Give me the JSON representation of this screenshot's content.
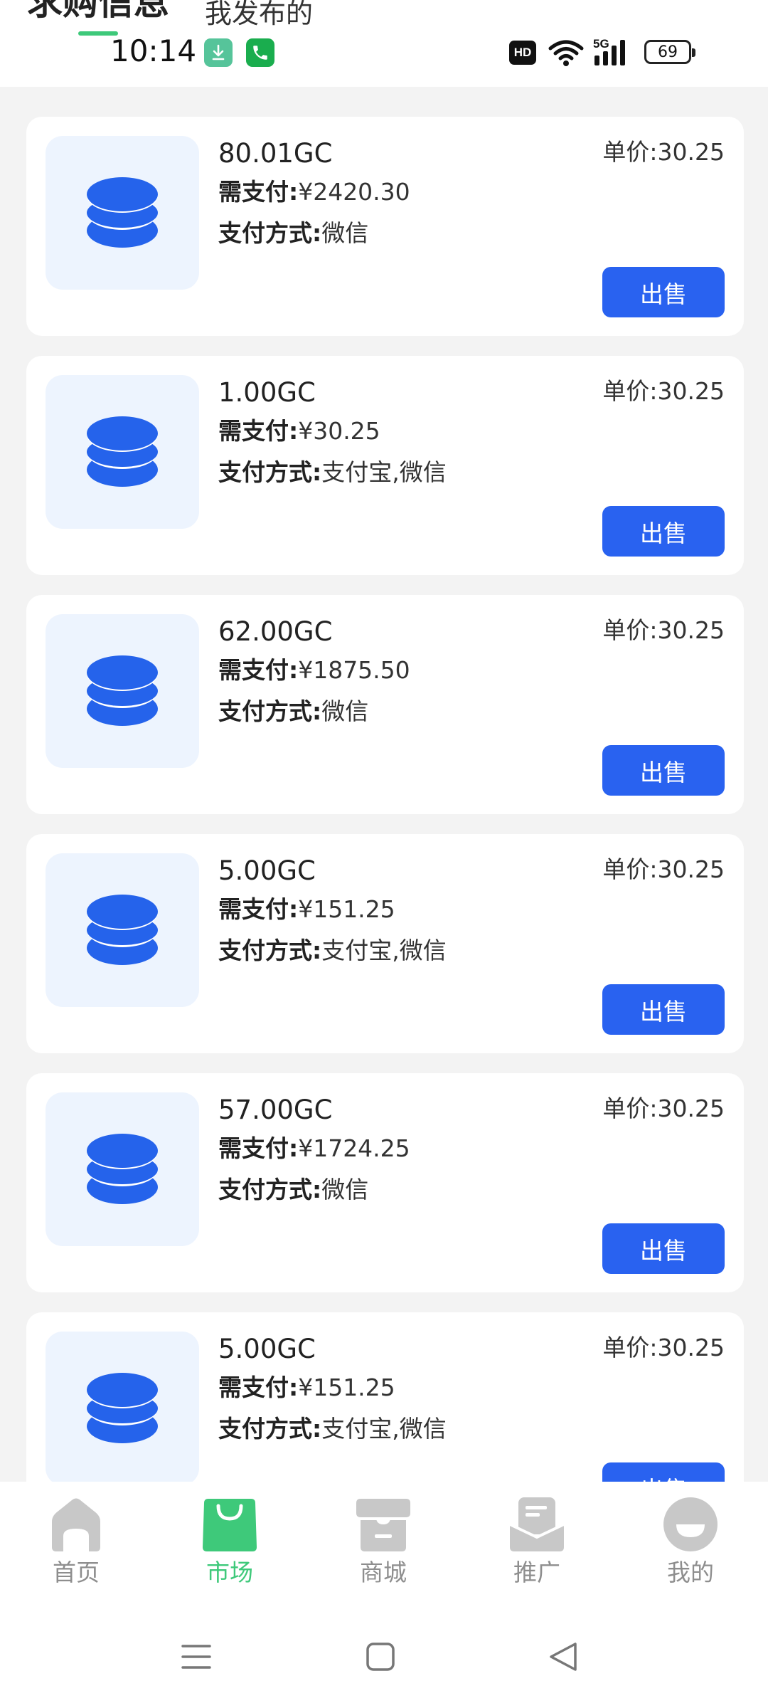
{
  "header": {
    "tab_active": "求购信息",
    "tab_other": "我发布的",
    "accent_color": "#3ec97a"
  },
  "status_bar": {
    "time": "10:14",
    "hd_badge": "HD",
    "network": "5G",
    "battery": "69",
    "icons": [
      "download-icon",
      "phone-icon",
      "wifi-icon",
      "signal-icon",
      "battery-icon"
    ]
  },
  "orders": [
    {
      "amount": "80.01GC",
      "pay_label": "需支付:",
      "pay_value": "¥2420.30",
      "method_label": "支付方式:",
      "method_value": "微信",
      "unit_label": "单价:",
      "unit_value": "30.25",
      "button": "出售"
    },
    {
      "amount": "1.00GC",
      "pay_label": "需支付:",
      "pay_value": "¥30.25",
      "method_label": "支付方式:",
      "method_value": "支付宝,微信",
      "unit_label": "单价:",
      "unit_value": "30.25",
      "button": "出售"
    },
    {
      "amount": "62.00GC",
      "pay_label": "需支付:",
      "pay_value": "¥1875.50",
      "method_label": "支付方式:",
      "method_value": "微信",
      "unit_label": "单价:",
      "unit_value": "30.25",
      "button": "出售"
    },
    {
      "amount": "5.00GC",
      "pay_label": "需支付:",
      "pay_value": "¥151.25",
      "method_label": "支付方式:",
      "method_value": "支付宝,微信",
      "unit_label": "单价:",
      "unit_value": "30.25",
      "button": "出售"
    },
    {
      "amount": "57.00GC",
      "pay_label": "需支付:",
      "pay_value": "¥1724.25",
      "method_label": "支付方式:",
      "method_value": "微信",
      "unit_label": "单价:",
      "unit_value": "30.25",
      "button": "出售"
    },
    {
      "amount": "5.00GC",
      "pay_label": "需支付:",
      "pay_value": "¥151.25",
      "method_label": "支付方式:",
      "method_value": "支付宝,微信",
      "unit_label": "单价:",
      "unit_value": "30.25",
      "button": "出售"
    }
  ],
  "colors": {
    "button_blue": "#2962f0",
    "icon_blue": "#2563eb",
    "icon_bg": "#edf4fe",
    "nav_active": "#3ec97a",
    "nav_inactive": "#c8c8c8"
  },
  "bottom_nav": {
    "items": [
      {
        "label": "首页",
        "icon": "home-icon",
        "active": false
      },
      {
        "label": "市场",
        "icon": "shopping-bag-icon",
        "active": true
      },
      {
        "label": "商城",
        "icon": "store-icon",
        "active": false
      },
      {
        "label": "推广",
        "icon": "envelope-icon",
        "active": false
      },
      {
        "label": "我的",
        "icon": "profile-face-icon",
        "active": false
      }
    ]
  },
  "system_nav": {
    "icons": [
      "menu-icon",
      "home-square-icon",
      "back-triangle-icon"
    ]
  }
}
